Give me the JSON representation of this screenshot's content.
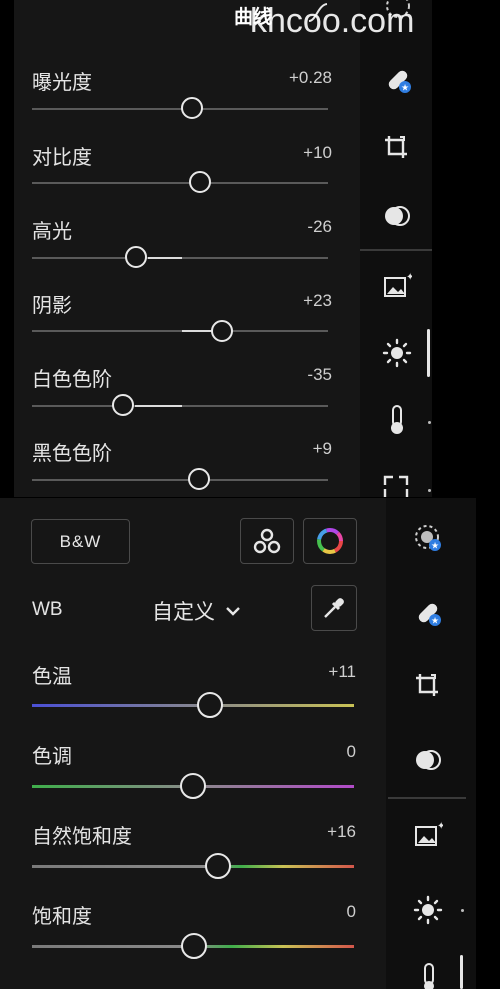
{
  "header": {
    "curve_tab": "曲线",
    "watermark": "khcoo.com"
  },
  "light": {
    "sliders": [
      {
        "label": "曝光度",
        "value": "+0.28",
        "position": 0.64
      },
      {
        "label": "对比度",
        "value": "+10",
        "position": 0.57
      },
      {
        "label": "高光",
        "value": "-26",
        "position": 0.35
      },
      {
        "label": "阴影",
        "value": "+23",
        "position": 0.64
      },
      {
        "label": "白色色阶",
        "value": "-35",
        "position": 0.27
      },
      {
        "label": "黑色色阶",
        "value": "+9",
        "position": 0.57
      }
    ]
  },
  "color": {
    "bw_label": "B&W",
    "wb_label": "WB",
    "wb_value": "自定义",
    "sliders": [
      {
        "label": "色温",
        "value": "+11",
        "position": 0.55
      },
      {
        "label": "色调",
        "value": "0",
        "position": 0.5
      },
      {
        "label": "自然饱和度",
        "value": "+16",
        "position": 0.58
      },
      {
        "label": "饱和度",
        "value": "0",
        "position": 0.5
      }
    ]
  },
  "toolbar": {
    "icons": [
      "selective-edit-icon",
      "healing-icon",
      "crop-icon",
      "masking-icon",
      "presets-icon",
      "light-icon",
      "color-icon",
      "effects-icon"
    ]
  },
  "colors": {
    "panel": "#161616",
    "rail": "#0f0f0f",
    "accent_blue": "#2f7de1",
    "temp_left": "#4b50d6",
    "temp_right": "#c9c255",
    "tint_left": "#3fae4b",
    "tint_right": "#b24bc9"
  }
}
